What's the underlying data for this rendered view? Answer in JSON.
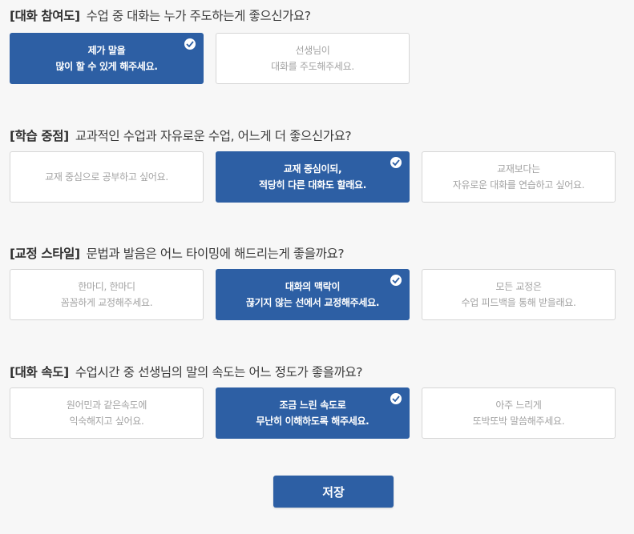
{
  "questions": [
    {
      "tag": "[대화 참여도]",
      "text": "수업 중 대화는 누가 주도하는게 좋으신가요?",
      "options": [
        {
          "line1": "제가 말을",
          "line2": "많이 할 수 있게 해주세요.",
          "selected": true
        },
        {
          "line1": "선생님이",
          "line2": "대화를 주도해주세요.",
          "selected": false
        }
      ]
    },
    {
      "tag": "[학습 중점]",
      "text": "교과적인 수업과 자유로운 수업, 어느게 더 좋으신가요?",
      "options": [
        {
          "line1": "교재 중심으로 공부하고 싶어요.",
          "line2": "",
          "selected": false
        },
        {
          "line1": "교재 중심이되,",
          "line2": "적당히 다른 대화도 할래요.",
          "selected": true
        },
        {
          "line1": "교재보다는",
          "line2": "자유로운 대화를 연습하고 싶어요.",
          "selected": false
        }
      ]
    },
    {
      "tag": "[교정 스타일]",
      "text": "문법과 발음은 어느 타이밍에 해드리는게 좋을까요?",
      "options": [
        {
          "line1": "한마디, 한마디",
          "line2": "꼼꼼하게 교정해주세요.",
          "selected": false
        },
        {
          "line1": "대화의 맥락이",
          "line2": "끊기지 않는 선에서 교정해주세요.",
          "selected": true
        },
        {
          "line1": "모든 교정은",
          "line2": "수업 피드백을 통해 받을래요.",
          "selected": false
        }
      ]
    },
    {
      "tag": "[대화 속도]",
      "text": "수업시간 중 선생님의 말의 속도는 어느 정도가 좋을까요?",
      "options": [
        {
          "line1": "원어민과 같은속도에",
          "line2": "익숙해지고 싶어요.",
          "selected": false
        },
        {
          "line1": "조금 느린 속도로",
          "line2": "무난히 이해하도록 해주세요.",
          "selected": true
        },
        {
          "line1": "아주 느리게",
          "line2": "또박또박 말씀해주세요.",
          "selected": false
        }
      ]
    }
  ],
  "save_label": "저장",
  "colors": {
    "accent": "#2d5fa4",
    "background": "#f7f7f7",
    "option_border": "#d6d6d6",
    "option_text": "#a3a3a3"
  },
  "icons": {
    "check": "check-circle-icon"
  }
}
